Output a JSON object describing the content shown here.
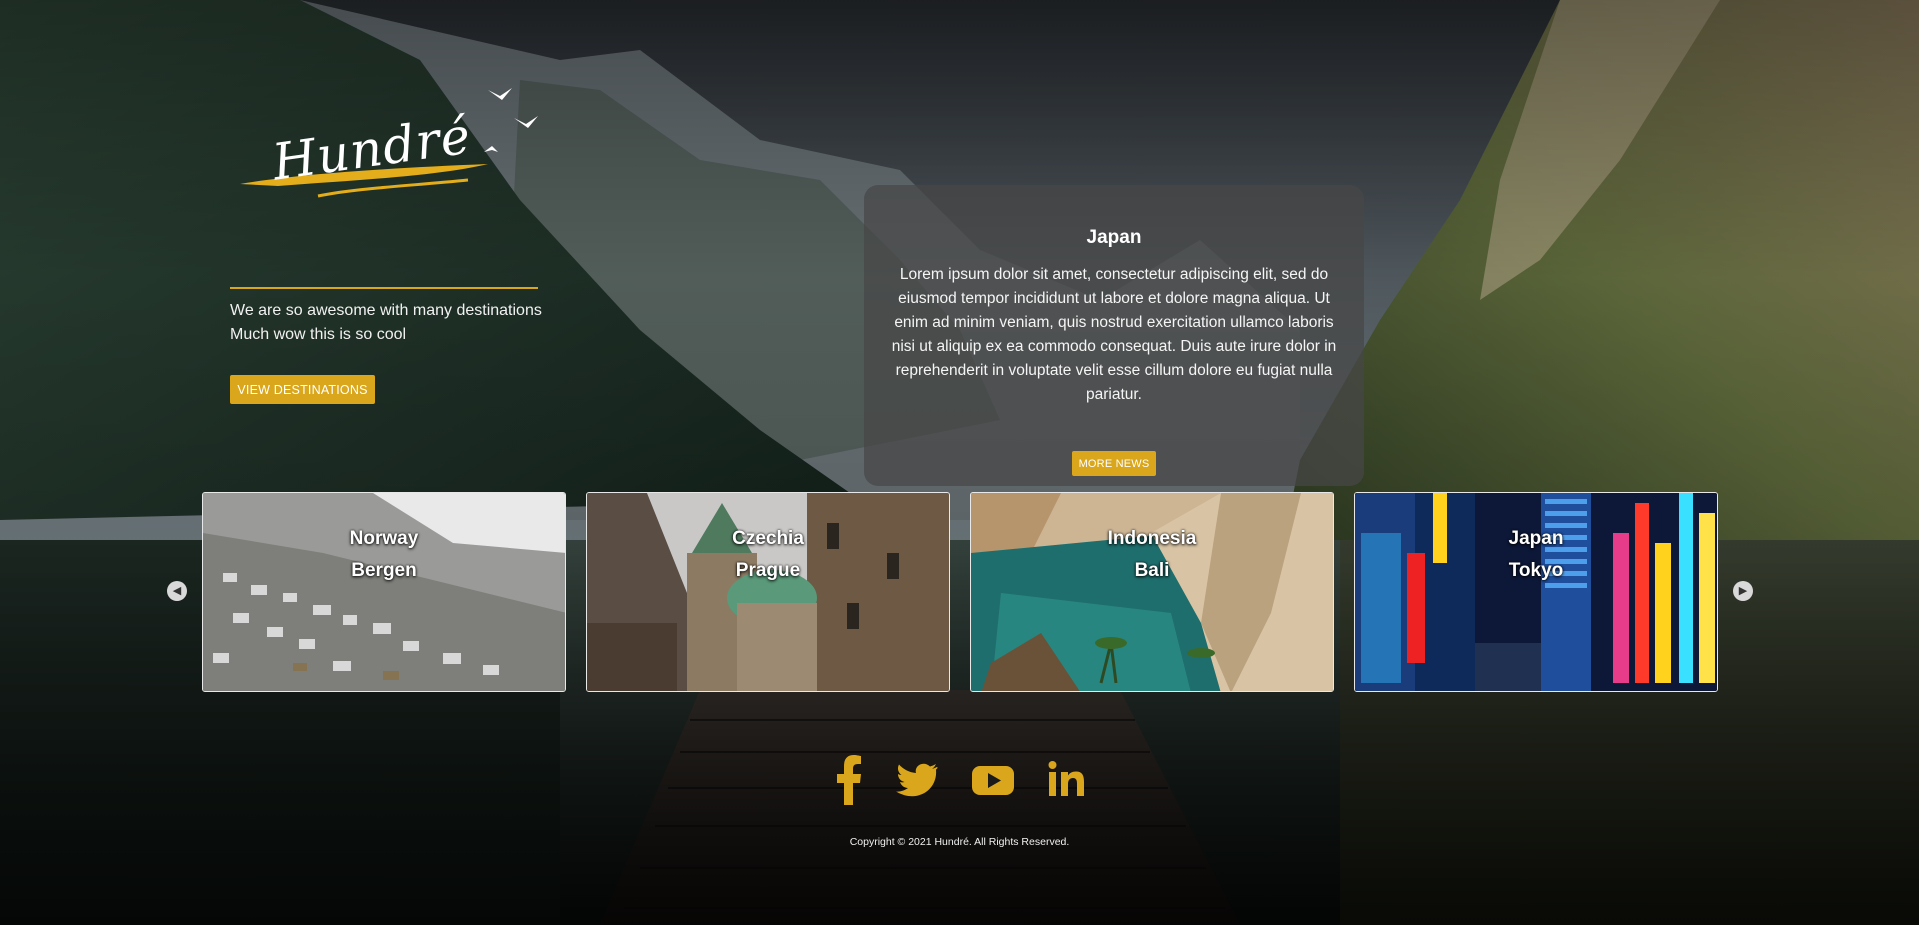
{
  "brand": {
    "logo_text": "Hundré"
  },
  "intro": {
    "line1": "We are so awesome with many destinations",
    "line2": "Much wow this is so cool",
    "button_label": "VIEW DESTINATIONS"
  },
  "news": {
    "title": "Japan",
    "body": "Lorem ipsum dolor sit amet, consectetur adipiscing elit, sed do eiusmod tempor incididunt ut labore et dolore magna aliqua. Ut enim ad minim veniam, quis nostrud exercitation ullamco laboris nisi ut aliquip ex ea commodo consequat. Duis aute irure dolor in reprehenderit in voluptate velit esse cillum dolore eu fugiat nulla pariatur.",
    "button_label": "MORE NEWS"
  },
  "carousel": {
    "prev_icon": "chevron-left-icon",
    "next_icon": "chevron-right-icon",
    "cards": [
      {
        "country": "Norway",
        "city": "Bergen"
      },
      {
        "country": "Czechia",
        "city": "Prague"
      },
      {
        "country": "Indonesia",
        "city": "Bali"
      },
      {
        "country": "Japan",
        "city": "Tokyo"
      }
    ]
  },
  "social": {
    "icons": [
      "facebook-icon",
      "twitter-icon",
      "youtube-icon",
      "linkedin-icon"
    ]
  },
  "footer": {
    "copyright": "Copyright © 2021 Hundré. All Rights Reserved."
  },
  "colors": {
    "accent": "#d9a61c",
    "card_bg": "#464646"
  }
}
